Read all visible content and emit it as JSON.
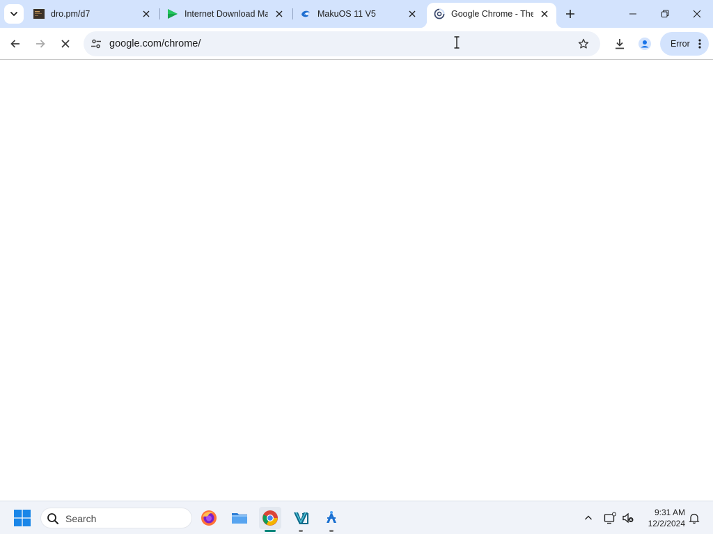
{
  "browser": {
    "tabs": [
      {
        "title": "dro.pm/d7",
        "favicon": "dark-thumbnail-icon",
        "active": false
      },
      {
        "title": "Internet Download Ma",
        "favicon": "green-play-icon",
        "active": false
      },
      {
        "title": "MakuOS 11 V5",
        "favicon": "blue-swirl-icon",
        "active": false
      },
      {
        "title": "Google Chrome - The",
        "favicon": "chrome-loading-icon",
        "active": true
      }
    ],
    "toolbar": {
      "url": "google.com/chrome/",
      "profile_status": "Error"
    },
    "colors": {
      "tabstrip": "#d3e3fd",
      "omnibox": "#eef2f9",
      "error_chip": "#d3e3fd"
    }
  },
  "taskbar": {
    "search_placeholder": "Search",
    "apps": [
      {
        "name": "firefox",
        "active": false
      },
      {
        "name": "file-explorer",
        "active": false
      },
      {
        "name": "google-chrome",
        "active": true
      },
      {
        "name": "visual-studio-app",
        "active": false
      },
      {
        "name": "accessibility-app",
        "active": false
      }
    ],
    "clock": {
      "time": "9:31 AM",
      "date": "12/2/2024"
    }
  }
}
